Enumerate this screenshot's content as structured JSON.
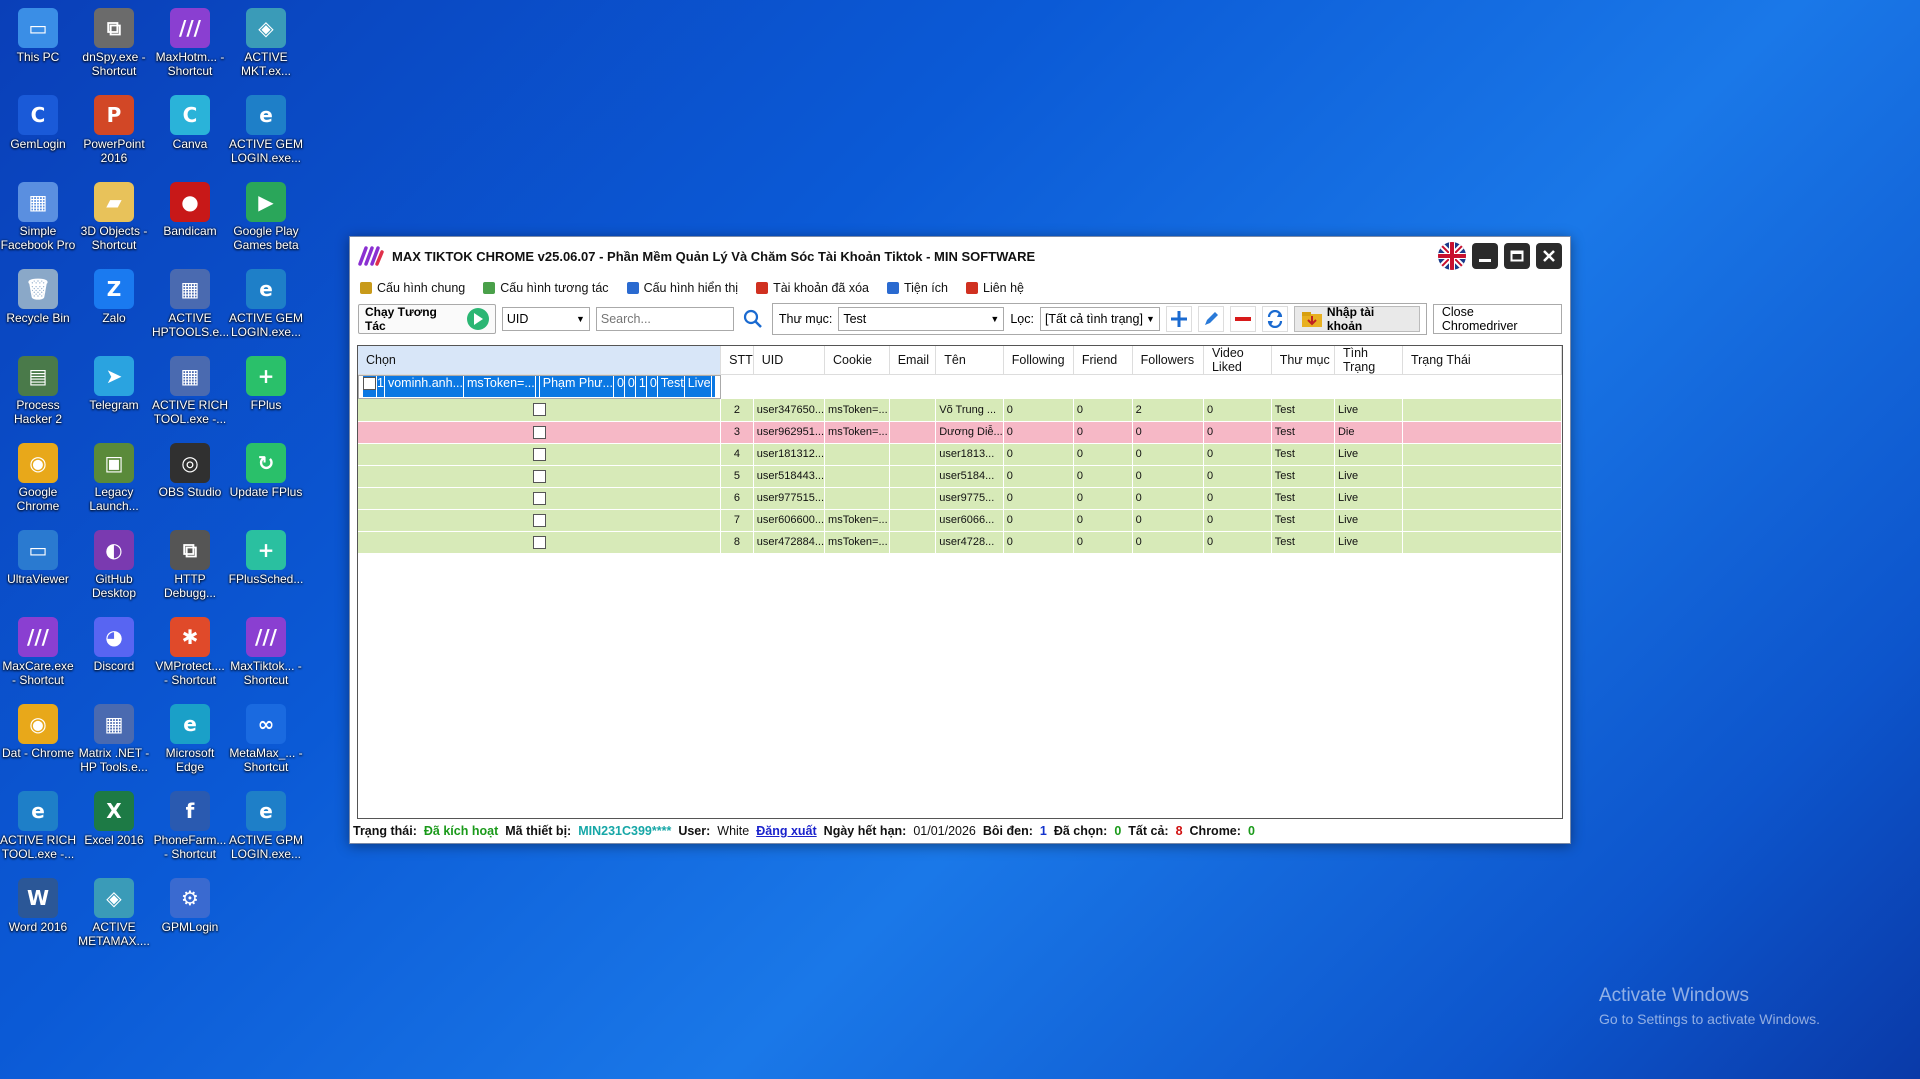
{
  "desktop_icons": [
    {
      "label": "This PC",
      "icon": "pc-icon",
      "color": "#3a8ee6",
      "glyph": "▭"
    },
    {
      "label": "dnSpy.exe - Shortcut",
      "icon": "dnspy-icon",
      "color": "#6b6b6b",
      "glyph": "⧉"
    },
    {
      "label": "MaxHotm... - Shortcut",
      "icon": "max-logo-icon",
      "color": "#8a3fd1",
      "glyph": "///"
    },
    {
      "label": "ACTIVE MKT.ex...",
      "icon": "active-mkt-icon",
      "color": "#3a9bb8",
      "glyph": "◈"
    },
    {
      "label": "GemLogin",
      "icon": "gemlogin-icon",
      "color": "#1a5ad8",
      "glyph": "C"
    },
    {
      "label": "PowerPoint 2016",
      "icon": "powerpoint-icon",
      "color": "#d24726",
      "glyph": "P"
    },
    {
      "label": "Canva",
      "icon": "canva-icon",
      "color": "#2ab3d9",
      "glyph": "C"
    },
    {
      "label": "ACTIVE GEM LOGIN.exe...",
      "icon": "edge-like-icon",
      "color": "#1e7fc8",
      "glyph": "e"
    },
    {
      "label": "Simple Facebook Pro",
      "icon": "simple-fb-icon",
      "color": "#5a8fe0",
      "glyph": "▦"
    },
    {
      "label": "3D Objects - Shortcut",
      "icon": "folder-3d-icon",
      "color": "#e8c25a",
      "glyph": "▰"
    },
    {
      "label": "Bandicam",
      "icon": "bandicam-icon",
      "color": "#c81818",
      "glyph": "●"
    },
    {
      "label": "Google Play Games beta",
      "icon": "play-games-icon",
      "color": "#2aa65a",
      "glyph": "▶"
    },
    {
      "label": "Recycle Bin",
      "icon": "recycle-bin-icon",
      "color": "#8aa8c8",
      "glyph": "🗑"
    },
    {
      "label": "Zalo",
      "icon": "zalo-icon",
      "color": "#1a7af0",
      "glyph": "Z"
    },
    {
      "label": "ACTIVE HPTOOLS.e...",
      "icon": "hptools-icon",
      "color": "#4a6ab0",
      "glyph": "▦"
    },
    {
      "label": "ACTIVE GEM LOGIN.exe...",
      "icon": "edge-like-icon",
      "color": "#1e7fc8",
      "glyph": "e"
    },
    {
      "label": "Process Hacker 2",
      "icon": "process-hacker-icon",
      "color": "#4a7a4a",
      "glyph": "▤"
    },
    {
      "label": "Telegram",
      "icon": "telegram-icon",
      "color": "#2aa3e0",
      "glyph": "➤"
    },
    {
      "label": "ACTIVE RICH TOOL.exe -...",
      "icon": "rich-tool-icon",
      "color": "#4a6ab0",
      "glyph": "▦"
    },
    {
      "label": "FPlus",
      "icon": "fplus-icon",
      "color": "#2ac06a",
      "glyph": "+"
    },
    {
      "label": "Google Chrome",
      "icon": "chrome-icon",
      "color": "#e8a81a",
      "glyph": "◉"
    },
    {
      "label": "Legacy Launch...",
      "icon": "minecraft-icon",
      "color": "#5a8a3a",
      "glyph": "▣"
    },
    {
      "label": "OBS Studio",
      "icon": "obs-icon",
      "color": "#303030",
      "glyph": "◎"
    },
    {
      "label": "Update FPlus",
      "icon": "update-fplus-icon",
      "color": "#2ac06a",
      "glyph": "↻"
    },
    {
      "label": "UltraViewer",
      "icon": "ultraviewer-icon",
      "color": "#2a7ad0",
      "glyph": "▭"
    },
    {
      "label": "GitHub Desktop",
      "icon": "github-icon",
      "color": "#7a3ab0",
      "glyph": "◐"
    },
    {
      "label": "HTTP Debugg...",
      "icon": "http-debugger-icon",
      "color": "#555555",
      "glyph": "⧉"
    },
    {
      "label": "FPlusSched...",
      "icon": "fplus-sched-icon",
      "color": "#2ac0a0",
      "glyph": "+"
    },
    {
      "label": "MaxCare.exe - Shortcut",
      "icon": "max-logo-icon",
      "color": "#8a3fd1",
      "glyph": "///"
    },
    {
      "label": "Discord",
      "icon": "discord-icon",
      "color": "#5865f2",
      "glyph": "◕"
    },
    {
      "label": "VMProtect.... - Shortcut",
      "icon": "vmprotect-icon",
      "color": "#e04a2a",
      "glyph": "✱"
    },
    {
      "label": "MaxTiktok... - Shortcut",
      "icon": "max-logo-icon",
      "color": "#8a3fd1",
      "glyph": "///"
    },
    {
      "label": "Dat - Chrome",
      "icon": "chrome-profile-icon",
      "color": "#e8a81a",
      "glyph": "◉"
    },
    {
      "label": "Matrix .NET - HP Tools.e...",
      "icon": "matrix-net-icon",
      "color": "#4a6ab0",
      "glyph": "▦"
    },
    {
      "label": "Microsoft Edge",
      "icon": "edge-icon",
      "color": "#1aa0c8",
      "glyph": "e"
    },
    {
      "label": "MetaMax_... - Shortcut",
      "icon": "meta-icon",
      "color": "#1a6ae0",
      "glyph": "∞"
    },
    {
      "label": "ACTIVE RICH TOOL.exe -...",
      "icon": "edge-like-icon",
      "color": "#1e7fc8",
      "glyph": "e"
    },
    {
      "label": "Excel 2016",
      "icon": "excel-icon",
      "color": "#1d7a45",
      "glyph": "X"
    },
    {
      "label": "PhoneFarm... - Shortcut",
      "icon": "phonefarm-icon",
      "color": "#2a5ab0",
      "glyph": "f"
    },
    {
      "label": "ACTIVE GPM LOGIN.exe...",
      "icon": "edge-like-icon",
      "color": "#1e7fc8",
      "glyph": "e"
    },
    {
      "label": "Word 2016",
      "icon": "word-icon",
      "color": "#2b5797",
      "glyph": "W"
    },
    {
      "label": "ACTIVE METAMAX....",
      "icon": "active-metamax-icon",
      "color": "#3a9bb8",
      "glyph": "◈"
    },
    {
      "label": "GPMLogin",
      "icon": "gpmlogin-icon",
      "color": "#3a6ad0",
      "glyph": "⚙"
    }
  ],
  "activate_windows": {
    "line1": "Activate Windows",
    "line2": "Go to Settings to activate Windows."
  },
  "window": {
    "title": "MAX TIKTOK CHROME v25.06.07 - Phần Mềm Quản Lý Và Chăm Sóc Tài Khoản Tiktok - MIN SOFTWARE"
  },
  "menu": [
    {
      "label": "Cấu hình chung",
      "icon": "key-icon",
      "color": "#c89a1a"
    },
    {
      "label": "Cấu hình tương tác",
      "icon": "interact-config-icon",
      "color": "#4aa04a"
    },
    {
      "label": "Cấu hình hiển thị",
      "icon": "display-config-icon",
      "color": "#2a6ad0"
    },
    {
      "label": "Tài khoản đã xóa",
      "icon": "trash-icon",
      "color": "#d03020"
    },
    {
      "label": "Tiện ích",
      "icon": "grid-icon",
      "color": "#2a6ad0"
    },
    {
      "label": "Liên hệ",
      "icon": "contact-icon",
      "color": "#d03020"
    }
  ],
  "toolbar": {
    "run_label": "Chạy Tương Tác",
    "uid_select": "UID",
    "search_placeholder": "Search...",
    "folder_label": "Thư mục:",
    "folder_value": "Test",
    "filter_label": "Lọc:",
    "filter_value": "[Tất cả tình trạng]",
    "import_label": "Nhập tài khoản",
    "close_chromedriver": "Close Chromedriver"
  },
  "table": {
    "columns": [
      "Chọn",
      "STT",
      "UID",
      "Cookie",
      "Email",
      "Tên",
      "Following",
      "Friend",
      "Followers",
      "Video Liked",
      "Thư mục",
      "Tình Trạng",
      "Trạng Thái"
    ],
    "rows": [
      {
        "stt": "1",
        "uid": "vominh.anh...",
        "cookie": "msToken=...",
        "email": "",
        "ten": "Phạm Phư...",
        "following": "0",
        "friend": "0",
        "followers": "1",
        "video_liked": "0",
        "thu_muc": "Test",
        "tinh_trang": "Live",
        "trang_thai": "",
        "state": "sel"
      },
      {
        "stt": "2",
        "uid": "user347650...",
        "cookie": "msToken=...",
        "email": "",
        "ten": "Võ Trung ...",
        "following": "0",
        "friend": "0",
        "followers": "2",
        "video_liked": "0",
        "thu_muc": "Test",
        "tinh_trang": "Live",
        "trang_thai": "",
        "state": "live"
      },
      {
        "stt": "3",
        "uid": "user962951...",
        "cookie": "msToken=...",
        "email": "",
        "ten": "Dương Diễ...",
        "following": "0",
        "friend": "0",
        "followers": "0",
        "video_liked": "0",
        "thu_muc": "Test",
        "tinh_trang": "Die",
        "trang_thai": "",
        "state": "die"
      },
      {
        "stt": "4",
        "uid": "user181312...",
        "cookie": "",
        "email": "",
        "ten": "user1813...",
        "following": "0",
        "friend": "0",
        "followers": "0",
        "video_liked": "0",
        "thu_muc": "Test",
        "tinh_trang": "Live",
        "trang_thai": "",
        "state": "live"
      },
      {
        "stt": "5",
        "uid": "user518443...",
        "cookie": "",
        "email": "",
        "ten": "user5184...",
        "following": "0",
        "friend": "0",
        "followers": "0",
        "video_liked": "0",
        "thu_muc": "Test",
        "tinh_trang": "Live",
        "trang_thai": "",
        "state": "live"
      },
      {
        "stt": "6",
        "uid": "user977515...",
        "cookie": "",
        "email": "",
        "ten": "user9775...",
        "following": "0",
        "friend": "0",
        "followers": "0",
        "video_liked": "0",
        "thu_muc": "Test",
        "tinh_trang": "Live",
        "trang_thai": "",
        "state": "live"
      },
      {
        "stt": "7",
        "uid": "user606600...",
        "cookie": "msToken=...",
        "email": "",
        "ten": "user6066...",
        "following": "0",
        "friend": "0",
        "followers": "0",
        "video_liked": "0",
        "thu_muc": "Test",
        "tinh_trang": "Live",
        "trang_thai": "",
        "state": "live"
      },
      {
        "stt": "8",
        "uid": "user472884...",
        "cookie": "msToken=...",
        "email": "",
        "ten": "user4728...",
        "following": "0",
        "friend": "0",
        "followers": "0",
        "video_liked": "0",
        "thu_muc": "Test",
        "tinh_trang": "Live",
        "trang_thai": "",
        "state": "live"
      }
    ]
  },
  "status": {
    "trang_thai_label": "Trạng thái:",
    "trang_thai_value": "Đã kích hoạt",
    "device_label": "Mã thiết bị:",
    "device_value": "MIN231C399****",
    "user_label": "User:",
    "user_value": "White",
    "logout": "Đăng xuất",
    "expiry_label": "Ngày hết hạn:",
    "expiry_value": "01/01/2026",
    "highlight_label": "Bôi đen:",
    "highlight_value": "1",
    "selected_label": "Đã chọn:",
    "selected_value": "0",
    "total_label": "Tất cả:",
    "total_value": "8",
    "chrome_label": "Chrome:",
    "chrome_value": "0"
  }
}
